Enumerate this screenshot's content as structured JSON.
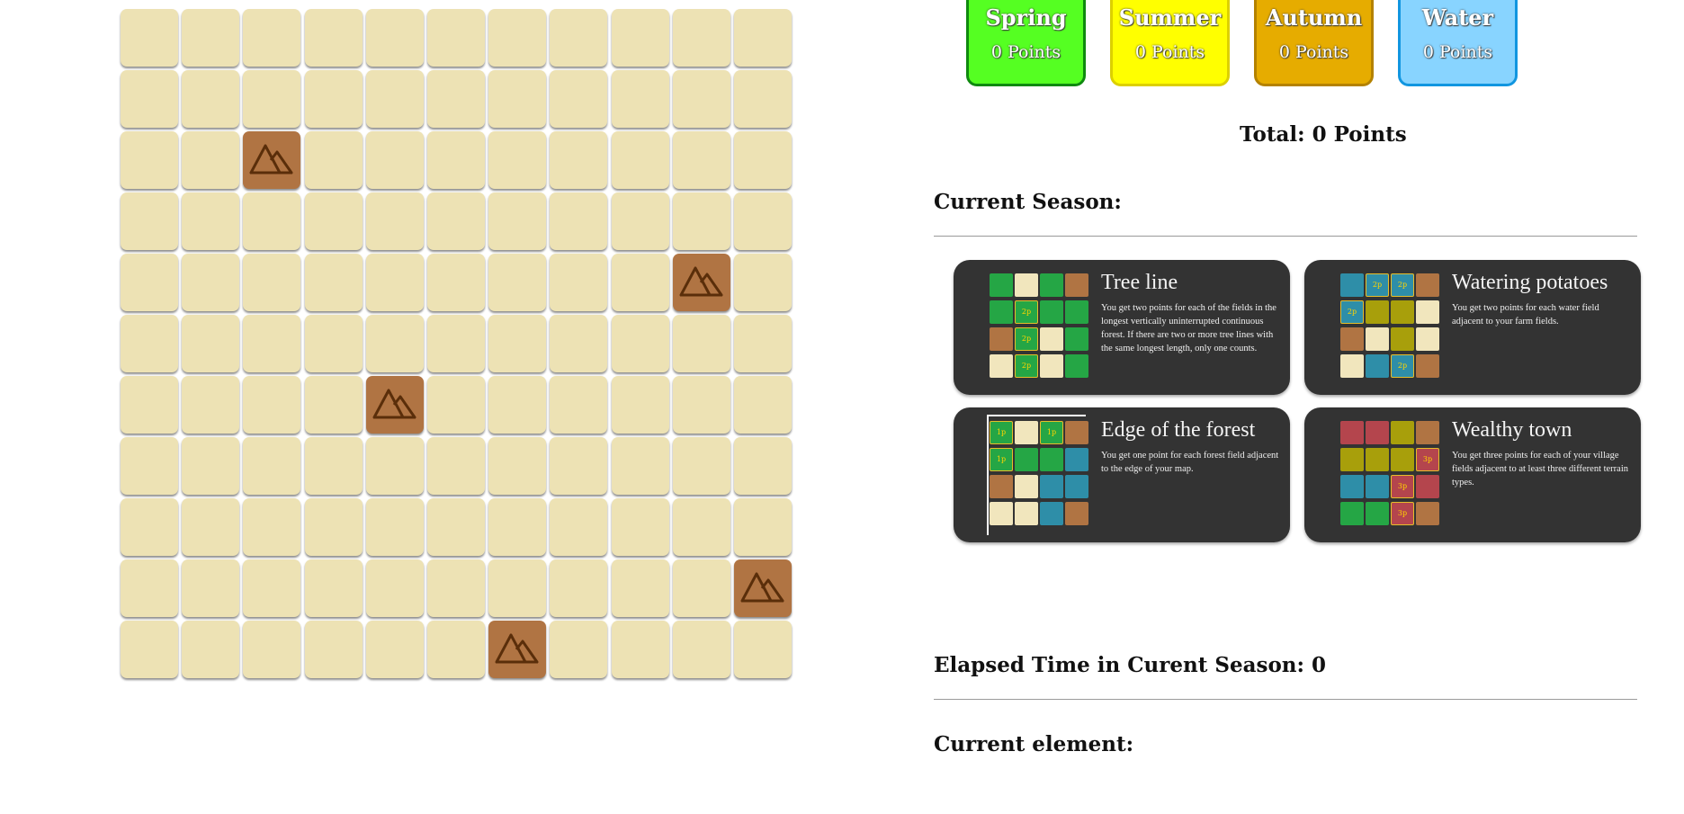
{
  "seasons": [
    {
      "name": "Spring",
      "points": "0 Points"
    },
    {
      "name": "Summer",
      "points": "0 Points"
    },
    {
      "name": "Autumn",
      "points": "0 Points"
    },
    {
      "name": "Water",
      "points": "0 Points"
    }
  ],
  "total": "Total: 0 Points",
  "current_season_label": "Current Season:",
  "elapsed_time": "Elapsed Time in Curent Season: 0",
  "current_element_label": "Current element:",
  "board": {
    "rows": 11,
    "cols": 11,
    "mountains": [
      [
        2,
        2
      ],
      [
        4,
        9
      ],
      [
        6,
        4
      ],
      [
        9,
        10
      ],
      [
        10,
        6
      ]
    ],
    "empty_color": "#ede2b4",
    "mountain_color": "#b07443",
    "mountain_icon": "mountain-icon"
  },
  "missions": [
    {
      "title": "Tree line",
      "description": "You get two points for each of the fields in the longest vertically uninterrupted continuous forest. If there are two or more tree lines with the same longest length, only one counts.",
      "grid": [
        [
          "g",
          "c",
          "g",
          "b"
        ],
        [
          "g",
          "g",
          "g",
          "g"
        ],
        [
          "b",
          "g",
          "c",
          "g"
        ],
        [
          "c",
          "g",
          "c",
          "g"
        ]
      ],
      "tags": [
        [
          "",
          "",
          "",
          ""
        ],
        [
          "",
          "2p",
          "",
          ""
        ],
        [
          "",
          "2p",
          "",
          ""
        ],
        [
          "",
          "2p",
          "",
          ""
        ]
      ]
    },
    {
      "title": "Watering potatoes",
      "description": "You get two points for each water field adjacent to your farm fields.",
      "grid": [
        [
          "w",
          "w",
          "w",
          "b"
        ],
        [
          "w",
          "o",
          "o",
          "c"
        ],
        [
          "b",
          "c",
          "o",
          "c"
        ],
        [
          "c",
          "w",
          "w",
          "b"
        ]
      ],
      "tags": [
        [
          "",
          "2p",
          "2p",
          ""
        ],
        [
          "2p",
          "",
          "",
          ""
        ],
        [
          "",
          "",
          "",
          ""
        ],
        [
          "",
          "",
          "2p",
          ""
        ]
      ]
    },
    {
      "title": "Edge of the forest",
      "description": "You get one point for each forest field adjacent to the edge of your map.",
      "grid": [
        [
          "g",
          "c",
          "g",
          "b"
        ],
        [
          "g",
          "g",
          "g",
          "w"
        ],
        [
          "b",
          "c",
          "w",
          "w"
        ],
        [
          "c",
          "c",
          "w",
          "b"
        ]
      ],
      "tags": [
        [
          "1p",
          "",
          "1p",
          ""
        ],
        [
          "1p",
          "",
          "",
          ""
        ],
        [
          "",
          "",
          "",
          ""
        ],
        [
          "",
          "",
          "",
          ""
        ]
      ]
    },
    {
      "title": "Wealthy town",
      "description": "You get three points for each of your village fields adjacent to at least three different terrain types.",
      "grid": [
        [
          "r",
          "r",
          "o",
          "b"
        ],
        [
          "o",
          "o",
          "o",
          "r"
        ],
        [
          "w",
          "w",
          "r",
          "r"
        ],
        [
          "g",
          "g",
          "r",
          "b"
        ]
      ],
      "tags": [
        [
          "",
          "",
          "",
          ""
        ],
        [
          "",
          "",
          "",
          "3p"
        ],
        [
          "",
          "",
          "3p",
          ""
        ],
        [
          "",
          "",
          "3p",
          ""
        ]
      ]
    }
  ],
  "colors": {
    "forest": "#25a645",
    "empty": "#f1e6bd",
    "mountain": "#b07443",
    "water": "#2e8ea8",
    "farm": "#a89f0b",
    "village": "#b4454d",
    "spring": "#55ff22",
    "summer": "#ffff00",
    "autumn": "#e6ac00",
    "water_season": "#88d4ff"
  }
}
